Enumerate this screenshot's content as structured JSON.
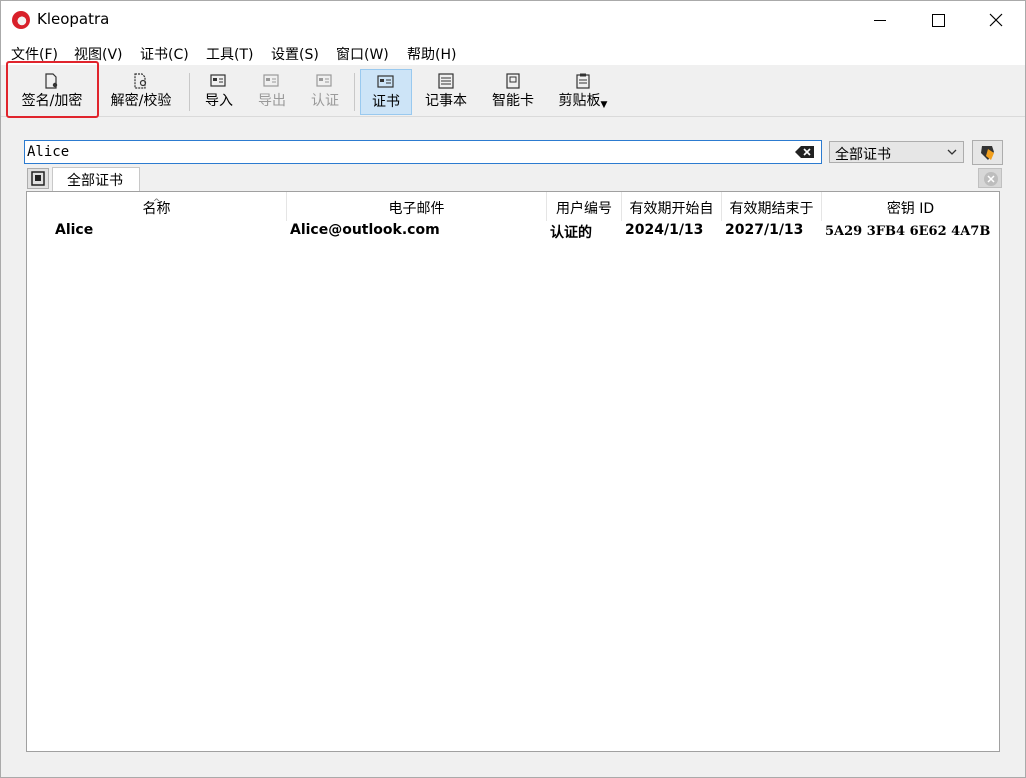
{
  "window": {
    "title": "Kleopatra"
  },
  "menu": [
    "文件(F)",
    "视图(V)",
    "证书(C)",
    "工具(T)",
    "设置(S)",
    "窗口(W)",
    "帮助(H)"
  ],
  "toolbar": {
    "sign_encrypt": "签名/加密",
    "decrypt_verify": "解密/校验",
    "import": "导入",
    "export": "导出",
    "certify": "认证",
    "certificates": "证书",
    "notepad": "记事本",
    "smartcard": "智能卡",
    "clipboard": "剪贴板"
  },
  "search": {
    "value": "Alice"
  },
  "filter": {
    "selected": "全部证书"
  },
  "tab": {
    "label": "全部证书"
  },
  "table": {
    "headers": [
      "名称",
      "电子邮件",
      "用户编号",
      "有效期开始自",
      "有效期结束于",
      "密钥 ID"
    ],
    "rows": [
      [
        "Alice",
        "Alice@outlook.com",
        "认证的",
        "2024/1/13",
        "2027/1/13",
        "5A29 3FB4 6E62 4A7B"
      ]
    ]
  },
  "icons": {
    "app": "kleopatra-icon",
    "sign_encrypt": "sign-encrypt-icon",
    "decrypt_verify": "decrypt-verify-icon",
    "import": "import-icon",
    "export": "export-icon",
    "certify": "certify-icon",
    "certificates": "certificates-icon",
    "notepad": "notepad-icon",
    "smartcard": "smartcard-icon",
    "clipboard": "clipboard-icon",
    "clear": "clear-search-icon",
    "cert_action": "certificate-shield-icon"
  },
  "colors": {
    "highlight": "#e0242c",
    "active_tab": "#cde4f7",
    "search_focus": "#2c7bd0"
  }
}
